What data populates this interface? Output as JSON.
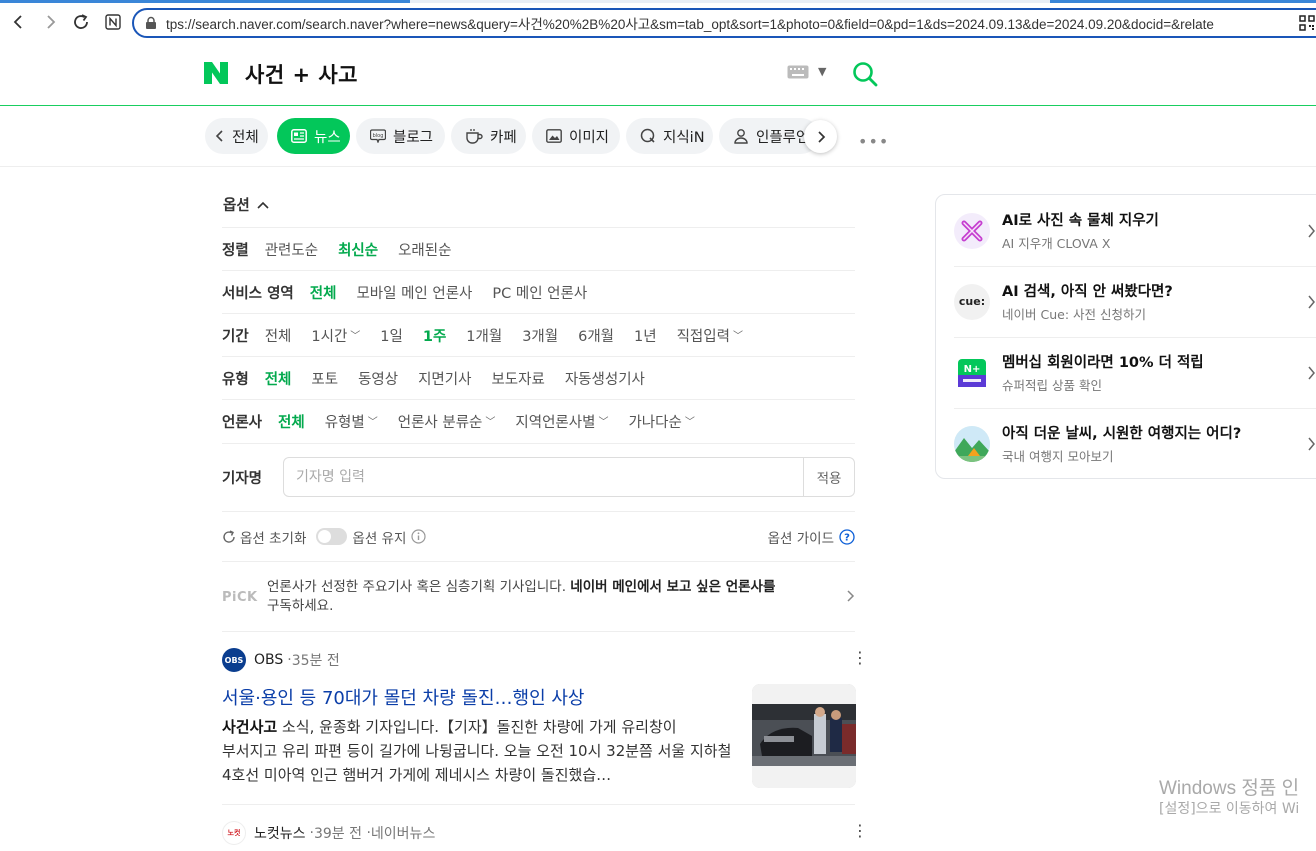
{
  "browser": {
    "url": "tps://search.naver.com/search.naver?where=news&query=사건%20%2B%20사고&sm=tab_opt&sort=1&photo=0&field=0&pd=1&ds=2024.09.13&de=2024.09.20&docid=&relate"
  },
  "header": {
    "query": "사건 + 사고",
    "brand_color": "#03c75a"
  },
  "tabs": [
    {
      "label": "전체",
      "icon": "chevron-left-icon",
      "active": false
    },
    {
      "label": "뉴스",
      "icon": "news-icon",
      "active": true
    },
    {
      "label": "블로그",
      "icon": "blog-icon",
      "active": false
    },
    {
      "label": "카페",
      "icon": "cafe-icon",
      "active": false
    },
    {
      "label": "이미지",
      "icon": "image-icon",
      "active": false
    },
    {
      "label": "지식iN",
      "icon": "kin-icon",
      "active": false
    },
    {
      "label": "인플루언서",
      "icon": "person-icon",
      "active": false
    }
  ],
  "options": {
    "title": "옵션",
    "sort": {
      "label": "정렬",
      "items": [
        "관련도순",
        "최신순",
        "오래된순"
      ],
      "selected": 1
    },
    "service": {
      "label": "서비스 영역",
      "items": [
        "전체",
        "모바일 메인 언론사",
        "PC 메인 언론사"
      ],
      "selected": 0
    },
    "period": {
      "label": "기간",
      "items": [
        "전체",
        "1시간",
        "1일",
        "1주",
        "1개월",
        "3개월",
        "6개월",
        "1년",
        "직접입력"
      ],
      "selected": 3
    },
    "type": {
      "label": "유형",
      "items": [
        "전체",
        "포토",
        "동영상",
        "지면기사",
        "보도자료",
        "자동생성기사"
      ],
      "selected": 0
    },
    "press": {
      "label": "언론사",
      "items": [
        "전체",
        "유형별",
        "언론사 분류순",
        "지역언론사별",
        "가나다순"
      ],
      "selected": 0
    },
    "reporter": {
      "label": "기자명",
      "placeholder": "기자명 입력",
      "value": "",
      "apply": "적용"
    },
    "reset": "옵션 초기화",
    "keep": "옵션 유지",
    "guide": "옵션 가이드"
  },
  "pick": {
    "badge": "PiCK",
    "text_normal": "언론사가 선정한 주요기사 혹은 심층기획 기사입니다. ",
    "text_bold": "네이버 메인에서 보고 싶은 언론사를",
    "text_tail": "구독하세요."
  },
  "news": [
    {
      "press": "OBS",
      "press_logo_text": "OBS",
      "time": "35분 전",
      "title": "서울·용인 등 70대가 몰던 차량 돌진…행인 사상",
      "body_bold": "사건사고",
      "body": " 소식, 윤종화 기자입니다.【기자】돌진한 차량에 가게 유리창이 부서지고 유리 파편 등이 길가에 나뒹굽니다. 오늘 오전 10시 32분쯤 서울 지하철 4호선 미아역 인근 햄버거 가게에 제네시스 차량이 돌진했습…"
    },
    {
      "press": "노컷뉴스",
      "press_logo_text": "노컷",
      "time": "39분 전",
      "extra": "네이버뉴스"
    }
  ],
  "side": [
    {
      "title": "AI로 사진 속 물체 지우기",
      "sub": "AI 지우개 CLOVA X",
      "icon": "ai-eraser-icon"
    },
    {
      "title": "AI 검색, 아직 안 써봤다면?",
      "sub": "네이버 Cue: 사전 신청하기",
      "icon": "cue-icon",
      "icon_text": "cue:"
    },
    {
      "title": "멤버십 회원이라면 10% 더 적립",
      "sub": "슈퍼적립 상품 확인",
      "icon": "naver-plus-icon",
      "icon_text": "N+"
    },
    {
      "title": "아직 더운 날씨, 시원한 여행지는 어디?",
      "sub": "국내 여행지 모아보기",
      "icon": "travel-icon"
    }
  ],
  "watermark": {
    "line1": "Windows 정품 인",
    "line2": "[설정]으로 이동하여 Wi"
  }
}
